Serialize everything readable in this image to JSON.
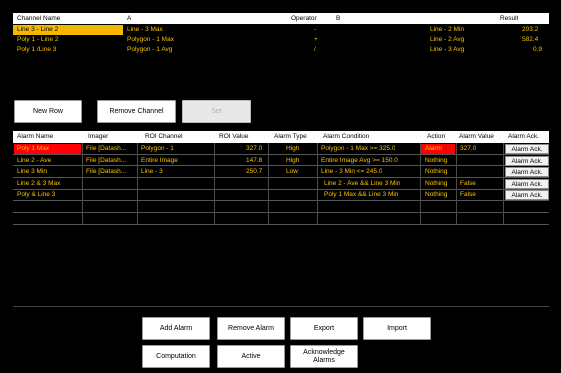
{
  "channels": {
    "headers": {
      "name": "Channel Name",
      "a": "A",
      "operator": "Operator",
      "b": "B",
      "result": "Result"
    },
    "rows": [
      {
        "name": "Line 3 - Line 2",
        "a": "Line - 3 Max",
        "operator": "-",
        "b": "Line - 2 Min",
        "result": "203.2"
      },
      {
        "name": "Poly 1 - Line 2",
        "a": "Polygon - 1 Max",
        "operator": "+",
        "b": "Line - 2 Avg",
        "result": "582.4"
      },
      {
        "name": "Poly 1 /Line 3",
        "a": "Polygon - 1 Avg",
        "operator": "/",
        "b": "Line - 3 Avg",
        "result": "0.9"
      }
    ]
  },
  "channel_buttons": {
    "new_row": "New Row",
    "remove_channel": "Remove Channel",
    "set": "Set"
  },
  "alarms": {
    "headers": {
      "name": "Alarm Name",
      "imager": "Imager",
      "roi_channel": "ROI Channel",
      "roi_value": "ROI Value",
      "type": "Alarm Type",
      "condition": "Alarm Condition",
      "action": "Action",
      "value": "Alarm Value",
      "ack": "Alarm Ack."
    },
    "rows": [
      {
        "name": "Poly 1 Max",
        "imager": "File [Datash...",
        "roi_channel": "Polygon - 1",
        "roi_value": "327.0",
        "type": "High",
        "condition": "Polygon - 1 Max >= 325.0",
        "action": "Alarm",
        "value": "327.0",
        "ack": "Alarm Ack."
      },
      {
        "name": "Line 2 - Ave",
        "imager": "File [Datash...",
        "roi_channel": "Entire Image",
        "roi_value": "147.8",
        "type": "High",
        "condition": "Entire Image Avg >= 150.0",
        "action": "Nothing",
        "value": "",
        "ack": "Alarm Ack."
      },
      {
        "name": "Line 3 Min",
        "imager": "File [Datash...",
        "roi_channel": "Line - 3",
        "roi_value": "250.7",
        "type": "Low",
        "condition": "Line - 3 Min <= 245.0",
        "action": "Nothing",
        "value": "",
        "ack": "Alarm Ack."
      },
      {
        "name": "Line 2 & 3 Max",
        "imager": "",
        "roi_channel": "",
        "roi_value": "",
        "type": "",
        "condition": "Line 2 - Ave && Line 3 Min",
        "action": "Nothing",
        "value": "False",
        "ack": "Alarm Ack."
      },
      {
        "name": "Poly & Line 3",
        "imager": "",
        "roi_channel": "",
        "roi_value": "",
        "type": "",
        "condition": "Poly 1 Max && Line 3 Min",
        "action": "Nothing",
        "value": "False",
        "ack": "Alarm Ack."
      }
    ]
  },
  "bottom_buttons": {
    "add_alarm": "Add Alarm",
    "remove_alarm": "Remove Alarm",
    "export": "Export",
    "import": "Import",
    "computation": "Computation",
    "active": "Active",
    "acknowledge_alarms": "Acknowledge Alarms"
  },
  "colors": {
    "selected_row": "#f5b800",
    "row_text": "#f5c400",
    "alarm_red": "#ff0000",
    "background": "#000000"
  }
}
